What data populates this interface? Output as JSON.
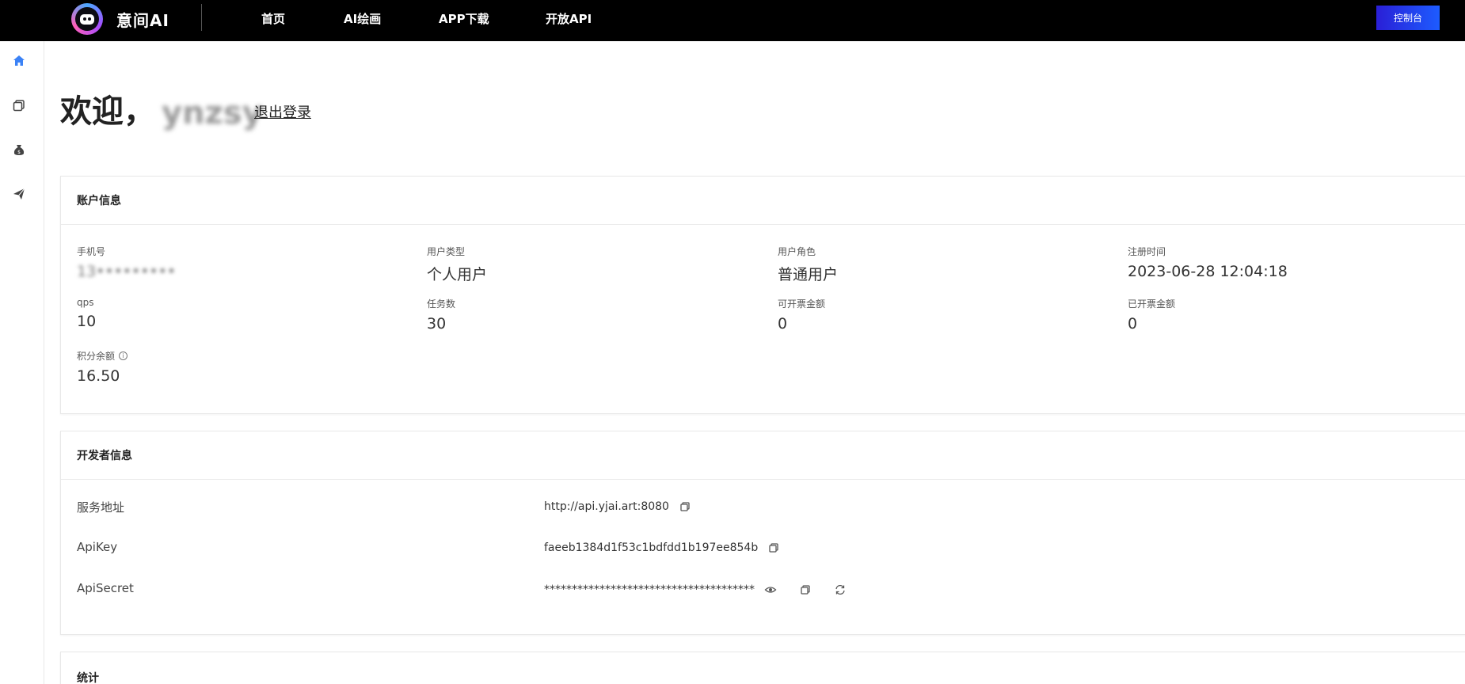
{
  "header": {
    "brand": "意间AI",
    "nav": [
      "首页",
      "AI绘画",
      "APP下载",
      "开放API"
    ],
    "console_button": "控制台"
  },
  "sidebar": {
    "icons": [
      "home-icon",
      "copy-icon",
      "money-bag-icon",
      "send-icon"
    ]
  },
  "welcome": {
    "greeting": "欢迎，",
    "username": "ynzsy",
    "logout": "退出登录"
  },
  "account": {
    "title": "账户信息",
    "fields": [
      {
        "label": "手机号",
        "value": "13•••••••••"
      },
      {
        "label": "用户类型",
        "value": "个人用户"
      },
      {
        "label": "用户角色",
        "value": "普通用户"
      },
      {
        "label": "注册时间",
        "value": "2023-06-28 12:04:18"
      },
      {
        "label": "qps",
        "value": "10"
      },
      {
        "label": "任务数",
        "value": "30"
      },
      {
        "label": "可开票金额",
        "value": "0"
      },
      {
        "label": "已开票金额",
        "value": "0"
      },
      {
        "label": "积分余额",
        "value": "16.50"
      }
    ]
  },
  "developer": {
    "title": "开发者信息",
    "rows": [
      {
        "label": "服务地址",
        "value": "http://api.yjai.art:8080"
      },
      {
        "label": "ApiKey",
        "value": "faeeb1384d1f53c1bdfdd1b197ee854b"
      },
      {
        "label": "ApiSecret",
        "value": "**************************************"
      }
    ]
  },
  "stats": {
    "title": "统计"
  },
  "colors": {
    "topbar": "#000000",
    "accent": "#1d5cff",
    "sidebar_active": "#3b82f6"
  }
}
